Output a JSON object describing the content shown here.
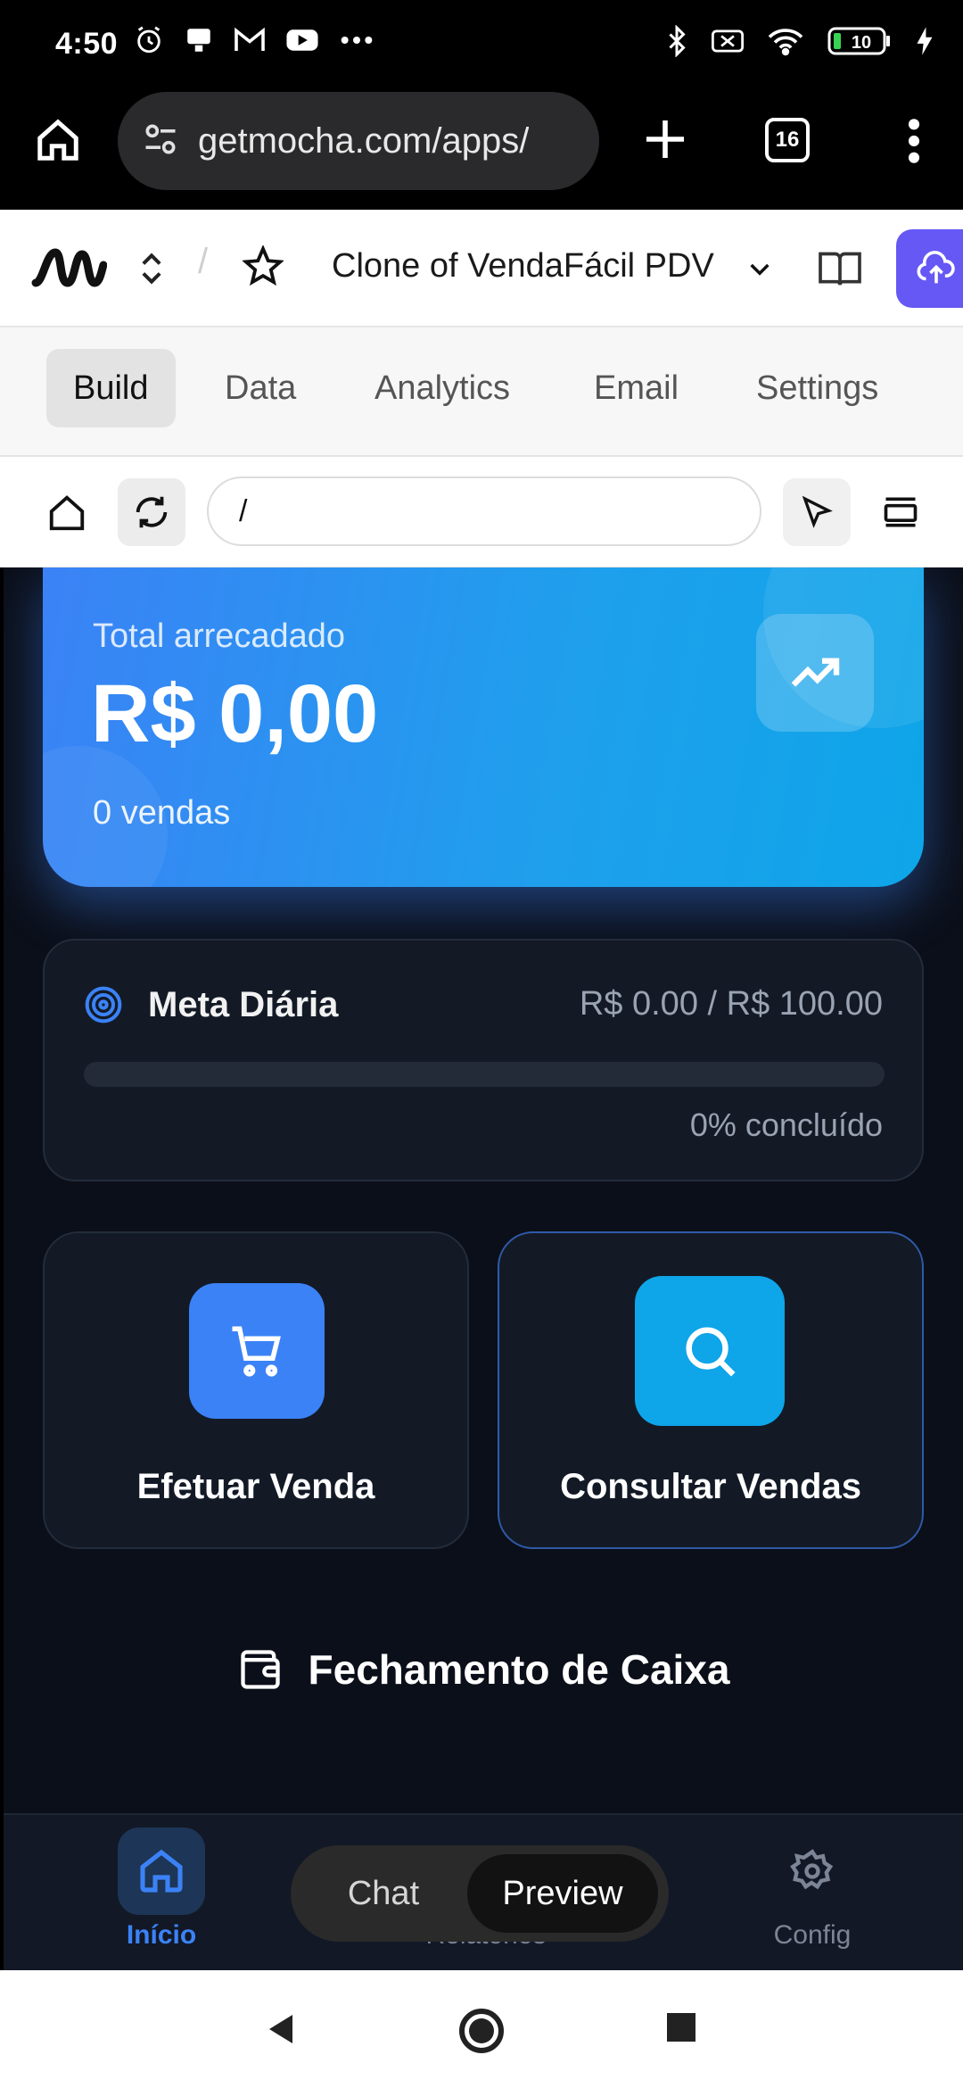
{
  "status_bar": {
    "time": "4:50",
    "battery": "10",
    "icons": [
      "alarm-icon",
      "notification-icon",
      "gmail-icon",
      "youtube-icon",
      "more-dots-icon",
      "bluetooth-icon",
      "sim-off-icon",
      "wifi-icon",
      "battery-icon",
      "charging-icon"
    ]
  },
  "browser": {
    "url": "getmocha.com/apps/",
    "tab_count": "16"
  },
  "app_header": {
    "project_name": "Clone of VendaFácil PDV",
    "separator": "/",
    "accent_color": "#6558f5"
  },
  "tabs": [
    {
      "label": "Build",
      "active": true
    },
    {
      "label": "Data",
      "active": false
    },
    {
      "label": "Analytics",
      "active": false
    },
    {
      "label": "Email",
      "active": false
    },
    {
      "label": "Settings",
      "active": false
    }
  ],
  "preview_toolbar": {
    "path_value": "/"
  },
  "app": {
    "total_card": {
      "label": "Total arrecadado",
      "amount": "R$ 0,00",
      "sales_count": "0 vendas"
    },
    "daily_goal": {
      "title": "Meta Diária",
      "value_text": "R$ 0.00 / R$ 100.00",
      "progress": 0,
      "percent_text": "0% concluído"
    },
    "actions": [
      {
        "label": "Efetuar Venda",
        "icon": "cart-icon",
        "color": "#3b82f6"
      },
      {
        "label": "Consultar Vendas",
        "icon": "search-icon",
        "color": "#0ea5e9"
      }
    ],
    "closing": {
      "label": "Fechamento de Caixa",
      "icon": "wallet-icon"
    },
    "bottom_nav": [
      {
        "label": "Início",
        "icon": "home-icon",
        "active": true
      },
      {
        "label": "Relatórios",
        "icon": "chart-icon",
        "active": false
      },
      {
        "label": "Config",
        "icon": "gear-icon",
        "active": false
      }
    ]
  },
  "view_toggle": {
    "chat_label": "Chat",
    "preview_label": "Preview",
    "selected": "Preview"
  }
}
